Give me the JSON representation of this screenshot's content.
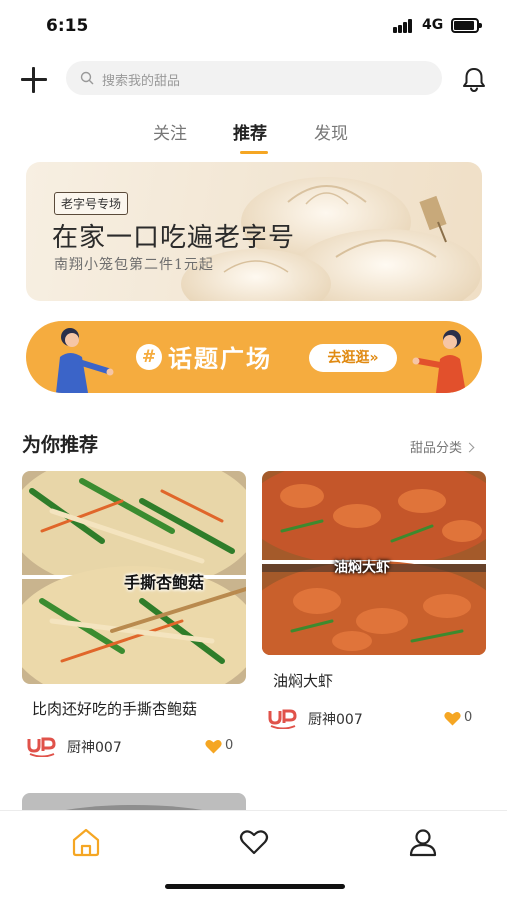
{
  "status_bar": {
    "time": "6:15",
    "network": "4G"
  },
  "header": {
    "search_placeholder": "搜索我的甜品"
  },
  "tabs": [
    {
      "label": "关注",
      "active": false
    },
    {
      "label": "推荐",
      "active": true
    },
    {
      "label": "发现",
      "active": false
    }
  ],
  "banner": {
    "tag": "老字号专场",
    "title": "在家一口吃遍老字号",
    "subtitle": "南翔小笼包第二件1元起"
  },
  "topic_banner": {
    "title": "话题广场",
    "button": "去逛逛»"
  },
  "section": {
    "title": "为你推荐",
    "link": "甜品分类"
  },
  "cards": [
    {
      "overlay_text": "手撕杏鲍菇",
      "title": "比肉还好吃的手撕杏鲍菇",
      "author": "厨神007",
      "likes": "0"
    },
    {
      "overlay_text": "油焖大虾",
      "title": "油焖大虾",
      "author": "厨神007",
      "likes": "0"
    }
  ],
  "bottom_nav": [
    {
      "icon": "home-icon",
      "active": true
    },
    {
      "icon": "heart-icon",
      "active": false
    },
    {
      "icon": "profile-icon",
      "active": false
    }
  ],
  "colors": {
    "accent": "#f5a623",
    "topic_bg": "#f5ac3f",
    "banner_bg": "#f2e6d3"
  }
}
